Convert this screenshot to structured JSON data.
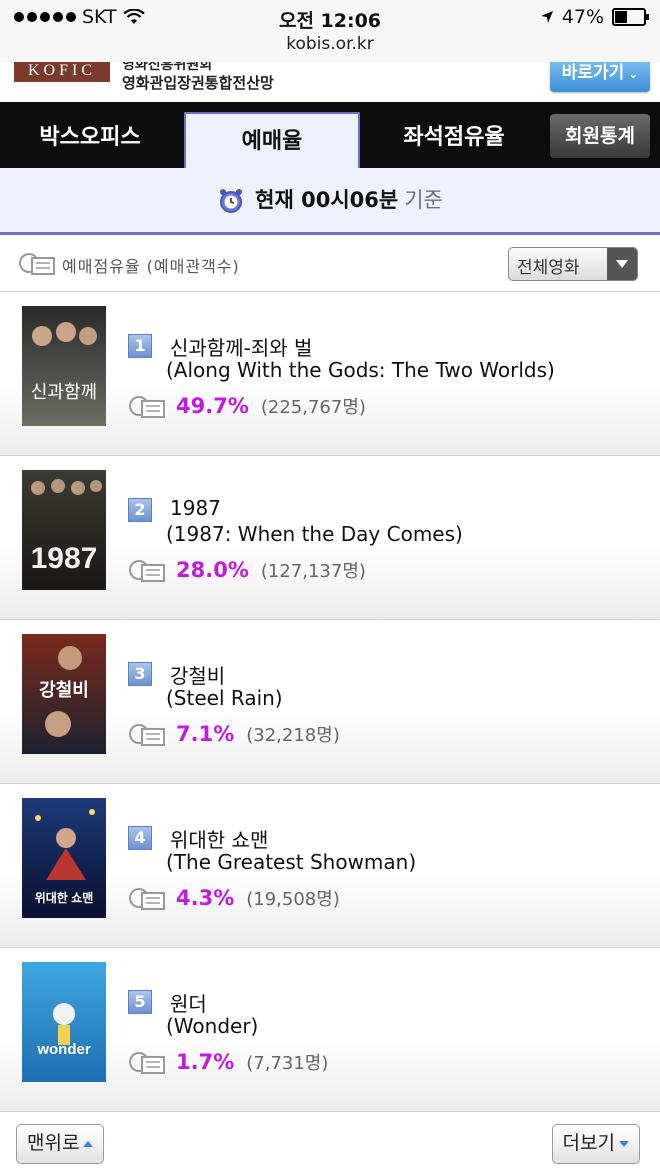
{
  "status_bar": {
    "carrier": "SKT",
    "time": "오전 12:06",
    "battery": "47%",
    "battery_level": 0.47,
    "url": "kobis.or.kr"
  },
  "banner": {
    "logo": "KOFIC",
    "line1": "영화진흥위원회",
    "line2": "영화관입장권통합전산망",
    "button": "바로가기"
  },
  "tabs": [
    {
      "label": "박스오피스",
      "active": false
    },
    {
      "label": "예매율",
      "active": true
    },
    {
      "label": "좌석점유율",
      "active": false
    },
    {
      "label": "회원통계",
      "active": false
    }
  ],
  "time_bar": {
    "now": "현재 00시06분",
    "base": "기준"
  },
  "subheader": {
    "label": "예매점유율 (예매관객수)",
    "filter": "전체영화"
  },
  "movies": [
    {
      "rank": "1",
      "title_ko": "신과함께-죄와 벌",
      "title_en": "(Along With the Gods: The Two Worlds)",
      "percent": "49.7%",
      "count": "(225,767명)",
      "poster_text": "신과함께",
      "poster_colors": [
        "#2a2a2a",
        "#6d6d66"
      ]
    },
    {
      "rank": "2",
      "title_ko": "1987",
      "title_en": "(1987: When the Day Comes)",
      "percent": "28.0%",
      "count": "(127,137명)",
      "poster_text": "1987",
      "poster_colors": [
        "#3d3a34",
        "#1a1815"
      ]
    },
    {
      "rank": "3",
      "title_ko": "강철비",
      "title_en": "(Steel Rain)",
      "percent": "7.1%",
      "count": "(32,218명)",
      "poster_text": "강철비",
      "poster_colors": [
        "#7a2a1c",
        "#1d2230"
      ]
    },
    {
      "rank": "4",
      "title_ko": "위대한 쇼맨",
      "title_en": "(The Greatest Showman)",
      "percent": "4.3%",
      "count": "(19,508명)",
      "poster_text": "위대한 쇼맨",
      "poster_colors": [
        "#1c3a78",
        "#0a1030"
      ]
    },
    {
      "rank": "5",
      "title_ko": "원더",
      "title_en": "(Wonder)",
      "percent": "1.7%",
      "count": "(7,731명)",
      "poster_text": "wonder",
      "poster_colors": [
        "#3fa7df",
        "#1e6fb0"
      ]
    }
  ],
  "footer": {
    "top_button": "맨위로",
    "more_button": "더보기"
  },
  "colors": {
    "accent": "#c21be0",
    "tab_border": "#6b6fcf",
    "rank_badge": "#6e93cf"
  }
}
